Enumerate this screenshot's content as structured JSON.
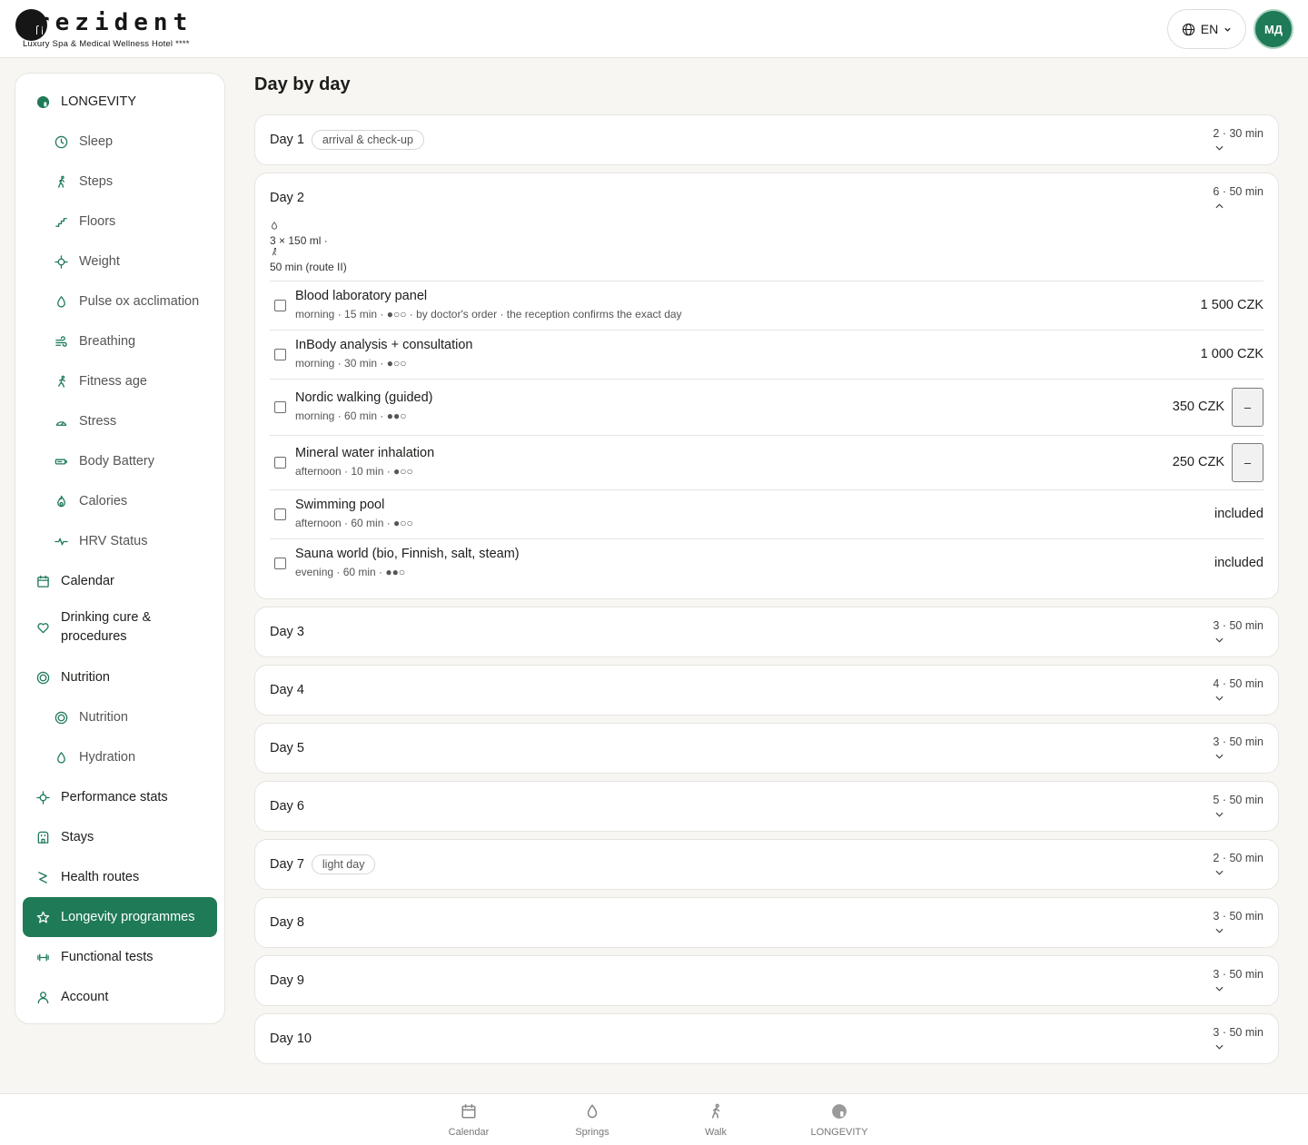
{
  "header": {
    "logo_word": "rezident",
    "logo_subtitle": "Luxury Spa & Medical Wellness Hotel ****",
    "language": "EN",
    "avatar_initials": "МД",
    "accent_color": "#1f7a57"
  },
  "sidebar": {
    "items": [
      {
        "label": "LONGEVITY",
        "icon": "longevity-icon",
        "level": "top"
      },
      {
        "label": "Sleep",
        "icon": "clock-icon",
        "level": "sub"
      },
      {
        "label": "Steps",
        "icon": "walking-icon",
        "level": "sub"
      },
      {
        "label": "Floors",
        "icon": "stairs-icon",
        "level": "sub"
      },
      {
        "label": "Weight",
        "icon": "crosshair-icon",
        "level": "sub"
      },
      {
        "label": "Pulse ox acclimation",
        "icon": "drop-icon",
        "level": "sub"
      },
      {
        "label": "Breathing",
        "icon": "wind-icon",
        "level": "sub"
      },
      {
        "label": "Fitness age",
        "icon": "running-icon",
        "level": "sub"
      },
      {
        "label": "Stress",
        "icon": "gauge-icon",
        "level": "sub"
      },
      {
        "label": "Body Battery",
        "icon": "battery-icon",
        "level": "sub"
      },
      {
        "label": "Calories",
        "icon": "flame-icon",
        "level": "sub"
      },
      {
        "label": "HRV Status",
        "icon": "pulse-icon",
        "level": "sub"
      },
      {
        "label": "Calendar",
        "icon": "calendar-icon",
        "level": "top"
      },
      {
        "label": "Drinking cure & procedures",
        "icon": "heart-icon",
        "level": "top"
      },
      {
        "label": "Nutrition",
        "icon": "target-icon",
        "level": "top"
      },
      {
        "label": "Nutrition",
        "icon": "target-icon",
        "level": "sub"
      },
      {
        "label": "Hydration",
        "icon": "drop-icon",
        "level": "sub"
      },
      {
        "label": "Performance stats",
        "icon": "crosshair-icon",
        "level": "top"
      },
      {
        "label": "Stays",
        "icon": "building-icon",
        "level": "top"
      },
      {
        "label": "Health routes",
        "icon": "route-icon",
        "level": "top"
      },
      {
        "label": "Longevity programmes",
        "icon": "star-icon",
        "level": "top",
        "active": true
      },
      {
        "label": "Functional tests",
        "icon": "dumbbell-icon",
        "level": "top"
      },
      {
        "label": "Account",
        "icon": "user-icon",
        "level": "top"
      }
    ]
  },
  "main": {
    "title": "Day by day",
    "days": [
      {
        "label": "Day 1",
        "tag": "arrival & check-up",
        "meta": "2 · 30 min",
        "expanded": false
      },
      {
        "label": "Day 2",
        "tag": "",
        "meta": "6 · 50 min",
        "expanded": true,
        "summary": {
          "water": "3 × 150 ml ·",
          "walk": "50 min (route II)"
        },
        "procedures": [
          {
            "name": "Blood laboratory panel",
            "sub": "morning · 15 min · ●○○ · by doctor's order · the reception confirms the exact day",
            "price": "1 500 CZK",
            "has_button": false
          },
          {
            "name": "InBody analysis + consultation",
            "sub": "morning · 30 min · ●○○",
            "price": "1 000 CZK",
            "has_button": false
          },
          {
            "name": "Nordic walking (guided)",
            "sub": "morning · 60 min · ●●○",
            "price": "350 CZK",
            "has_button": true,
            "button": "–"
          },
          {
            "name": "Mineral water inhalation",
            "sub": "afternoon · 10 min · ●○○",
            "price": "250 CZK",
            "has_button": true,
            "button": "–"
          },
          {
            "name": "Swimming pool",
            "sub": "afternoon · 60 min · ●○○",
            "price": "included",
            "has_button": false
          },
          {
            "name": "Sauna world (bio, Finnish, salt, steam)",
            "sub": "evening · 60 min · ●●○",
            "price": "included",
            "has_button": false
          }
        ]
      },
      {
        "label": "Day 3",
        "tag": "",
        "meta": "3 · 50 min",
        "expanded": false
      },
      {
        "label": "Day 4",
        "tag": "",
        "meta": "4 · 50 min",
        "expanded": false
      },
      {
        "label": "Day 5",
        "tag": "",
        "meta": "3 · 50 min",
        "expanded": false
      },
      {
        "label": "Day 6",
        "tag": "",
        "meta": "5 · 50 min",
        "expanded": false
      },
      {
        "label": "Day 7",
        "tag": "light day",
        "meta": "2 · 50 min",
        "expanded": false
      },
      {
        "label": "Day 8",
        "tag": "",
        "meta": "3 · 50 min",
        "expanded": false
      },
      {
        "label": "Day 9",
        "tag": "",
        "meta": "3 · 50 min",
        "expanded": false
      },
      {
        "label": "Day 10",
        "tag": "",
        "meta": "3 · 50 min",
        "expanded": false
      }
    ]
  },
  "bottom_nav": {
    "items": [
      {
        "label": "Calendar",
        "icon": "calendar-icon"
      },
      {
        "label": "Springs",
        "icon": "drop-icon"
      },
      {
        "label": "Walk",
        "icon": "walking-icon"
      },
      {
        "label": "LONGEVITY",
        "icon": "longevity-icon"
      }
    ]
  }
}
